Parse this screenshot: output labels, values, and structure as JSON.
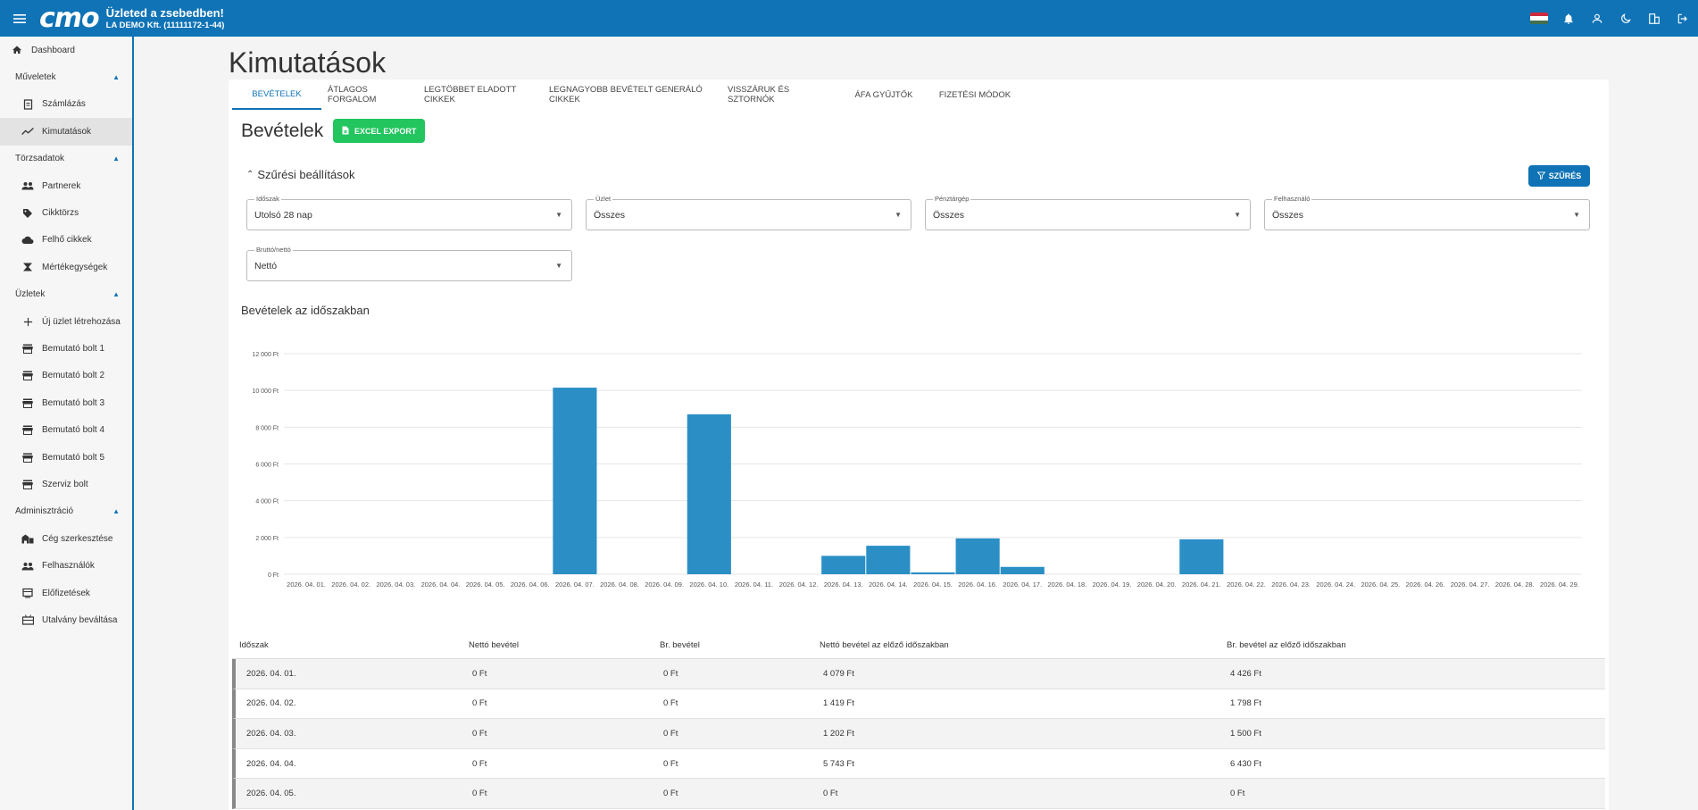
{
  "topbar": {
    "logo": "cmo",
    "slogan": "Üzleted a zsebedben!",
    "company": "LA DEMO Kft. (11111172-1-44)",
    "icons": [
      "flag-hu-icon",
      "bell-icon",
      "user-icon",
      "moon-icon",
      "building-icon",
      "logout-icon"
    ]
  },
  "sidebar": {
    "dashboard": "Dashboard",
    "groups": [
      {
        "label": "Műveletek",
        "items": [
          "Számlázás",
          "Kimutatások"
        ]
      },
      {
        "label": "Törzsadatok",
        "items": [
          "Partnerek",
          "Cikktörzs",
          "Felhő cikkek",
          "Mértékegységek"
        ]
      },
      {
        "label": "Üzletek",
        "items": [
          "Új üzlet létrehozása",
          "Bemutató bolt 1",
          "Bemutató bolt 2",
          "Bemutató bolt 3",
          "Bemutató bolt 4",
          "Bemutató bolt 5",
          "Szerviz bolt"
        ]
      },
      {
        "label": "Adminisztráció",
        "items": [
          "Cég szerkesztése",
          "Felhasználók",
          "Előfizetések",
          "Utalvány beváltása"
        ]
      }
    ]
  },
  "page": {
    "title": "Kimutatások",
    "tabs": [
      "Bevételek",
      "Átlagos forgalom",
      "Legtöbbet eladott cikkek",
      "Legnagyobb bevételt generáló cikkek",
      "Visszáruk és sztornók",
      "ÁFA gyűjtők",
      "Fizetési módok"
    ],
    "section_title": "Bevételek",
    "excel_export": "Excel export",
    "filter_toggle": "Szűrési beállítások",
    "filter_button": "Szűrés",
    "filters": [
      {
        "label": "Időszak",
        "value": "Utolsó 28 nap"
      },
      {
        "label": "Üzlet",
        "value": "Összes"
      },
      {
        "label": "Pénztárgép",
        "value": "Összes"
      },
      {
        "label": "Felhasználó",
        "value": "Összes"
      },
      {
        "label": "Bruttó/nettó",
        "value": "Nettó"
      }
    ],
    "chart_title": "Bevételek az időszakban"
  },
  "chart_data": {
    "type": "bar",
    "categories": [
      "2026. 04. 01.",
      "2026. 04. 02.",
      "2026. 04. 03.",
      "2026. 04. 04.",
      "2026. 04. 05.",
      "2026. 04. 06.",
      "2026. 04. 07.",
      "2026. 04. 08.",
      "2026. 04. 09.",
      "2026. 04. 10.",
      "2026. 04. 11.",
      "2026. 04. 12.",
      "2026. 04. 13.",
      "2026. 04. 14.",
      "2026. 04. 15.",
      "2026. 04. 16.",
      "2026. 04. 17.",
      "2026. 04. 18.",
      "2026. 04. 19.",
      "2026. 04. 20.",
      "2026. 04. 21.",
      "2026. 04. 22.",
      "2026. 04. 23.",
      "2026. 04. 24.",
      "2026. 04. 25.",
      "2026. 04. 26.",
      "2026. 04. 27.",
      "2026. 04. 28.",
      "2026. 04. 29."
    ],
    "values": [
      0,
      0,
      0,
      0,
      0,
      0,
      10150,
      0,
      0,
      8700,
      0,
      0,
      1000,
      1550,
      100,
      1950,
      400,
      0,
      0,
      0,
      1900,
      0,
      0,
      0,
      0,
      0,
      0,
      0,
      0
    ],
    "y_ticks": [
      "0 Ft",
      "2 000 Ft",
      "4 000 Ft",
      "6 000 Ft",
      "8 000 Ft",
      "10 000 Ft",
      "12 000 Ft"
    ],
    "ylim": [
      0,
      12000
    ],
    "grid": true,
    "color": "#2b8fc6"
  },
  "table": {
    "headers": [
      "Időszak",
      "Nettó bevétel",
      "Br. bevétel",
      "Nettó bevétel az előző időszakban",
      "Br. bevétel az előző időszakban"
    ],
    "rows": [
      [
        "2026. 04. 01.",
        "0 Ft",
        "0 Ft",
        "4 079 Ft",
        "4 426 Ft"
      ],
      [
        "2026. 04. 02.",
        "0 Ft",
        "0 Ft",
        "1 419 Ft",
        "1 798 Ft"
      ],
      [
        "2026. 04. 03.",
        "0 Ft",
        "0 Ft",
        "1 202 Ft",
        "1 500 Ft"
      ],
      [
        "2026. 04. 04.",
        "0 Ft",
        "0 Ft",
        "5 743 Ft",
        "6 430 Ft"
      ],
      [
        "2026. 04. 05.",
        "0 Ft",
        "0 Ft",
        "0 Ft",
        "0 Ft"
      ]
    ]
  }
}
